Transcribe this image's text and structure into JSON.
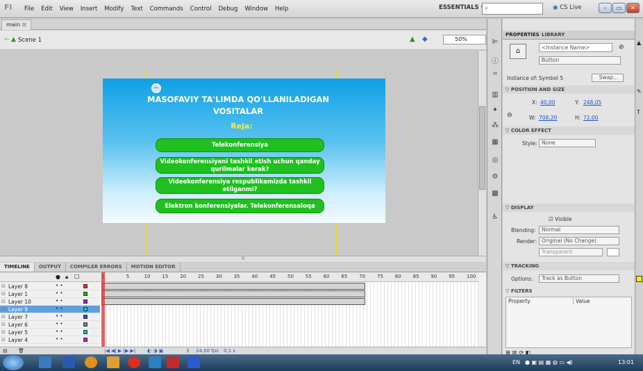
{
  "menubar": {
    "logo": "Fl",
    "items": [
      "File",
      "Edit",
      "View",
      "Insert",
      "Modify",
      "Text",
      "Commands",
      "Control",
      "Debug",
      "Window",
      "Help"
    ],
    "workspace": "ESSENTIALS ▾",
    "search_placeholder": "",
    "cslive": "CS Live"
  },
  "doc": {
    "tab": "main",
    "tab_close": "⊠",
    "scene": "Scene 1",
    "zoom": "50%"
  },
  "slide": {
    "title": "MASOFAVIY TA'LIMDA QO'LLANILADIGAN VOSITALAR",
    "subtitle": "Reja:",
    "buttons": [
      "Telekonferensiya",
      "Videokonferensiyani tashkil etish uchun qanday qurilmalar kerak?",
      "Videokonferensiya respublikamizda tashkil etilganmi?",
      "Elektron konferensiyalar. Telekonferensaloqa"
    ]
  },
  "hscroll_label": "III",
  "timeline": {
    "tabs": [
      "TIMELINE",
      "OUTPUT",
      "COMPILER ERRORS",
      "MOTION EDITOR"
    ],
    "frame_numbers": [
      "1",
      "5",
      "10",
      "15",
      "20",
      "25",
      "30",
      "35",
      "40",
      "45",
      "50",
      "55",
      "60",
      "65",
      "70",
      "75",
      "80",
      "85",
      "90",
      "95",
      "100"
    ],
    "layers": [
      {
        "name": "Layer 8",
        "color": "#e03030"
      },
      {
        "name": "Layer 1",
        "color": "#20b020"
      },
      {
        "name": "Layer 10",
        "color": "#9a20c0"
      },
      {
        "name": "Layer 9",
        "color": "#20c0c0"
      },
      {
        "name": "Layer 7",
        "color": "#2050e0"
      },
      {
        "name": "Layer 6",
        "color": "#808080"
      },
      {
        "name": "Layer 5",
        "color": "#20c0c0"
      },
      {
        "name": "Layer 4",
        "color": "#c020c0"
      }
    ],
    "fps": "24,00 fps",
    "time": "0,1 s",
    "frame": "3"
  },
  "properties": {
    "tabs": [
      "PROPERTIES",
      "LIBRARY"
    ],
    "instance_name_placeholder": "<Instance Name>",
    "type": "Button",
    "instance_of_label": "Instance of:",
    "instance_of": "Symbol 5",
    "swap": "Swap...",
    "pos_size_header": "POSITION AND SIZE",
    "x_label": "X:",
    "x": "40,00",
    "y_label": "Y:",
    "y": "248,05",
    "w_label": "W:",
    "w": "708,20",
    "h_label": "H:",
    "h": "72,00",
    "color_effect_header": "COLOR EFFECT",
    "style_label": "Style:",
    "style": "None",
    "display_header": "DISPLAY",
    "visible": "Visible",
    "blending_label": "Blending:",
    "blending": "Normal",
    "render_label": "Render:",
    "render": "Original (No Change)",
    "transparent": "Transparent",
    "tracking_header": "TRACKING",
    "options_label": "Options:",
    "options": "Track as Button",
    "filters_header": "FILTERS",
    "filter_cols": [
      "Property",
      "Value"
    ]
  },
  "taskbar": {
    "lang": "EN",
    "clock": "13:01"
  }
}
